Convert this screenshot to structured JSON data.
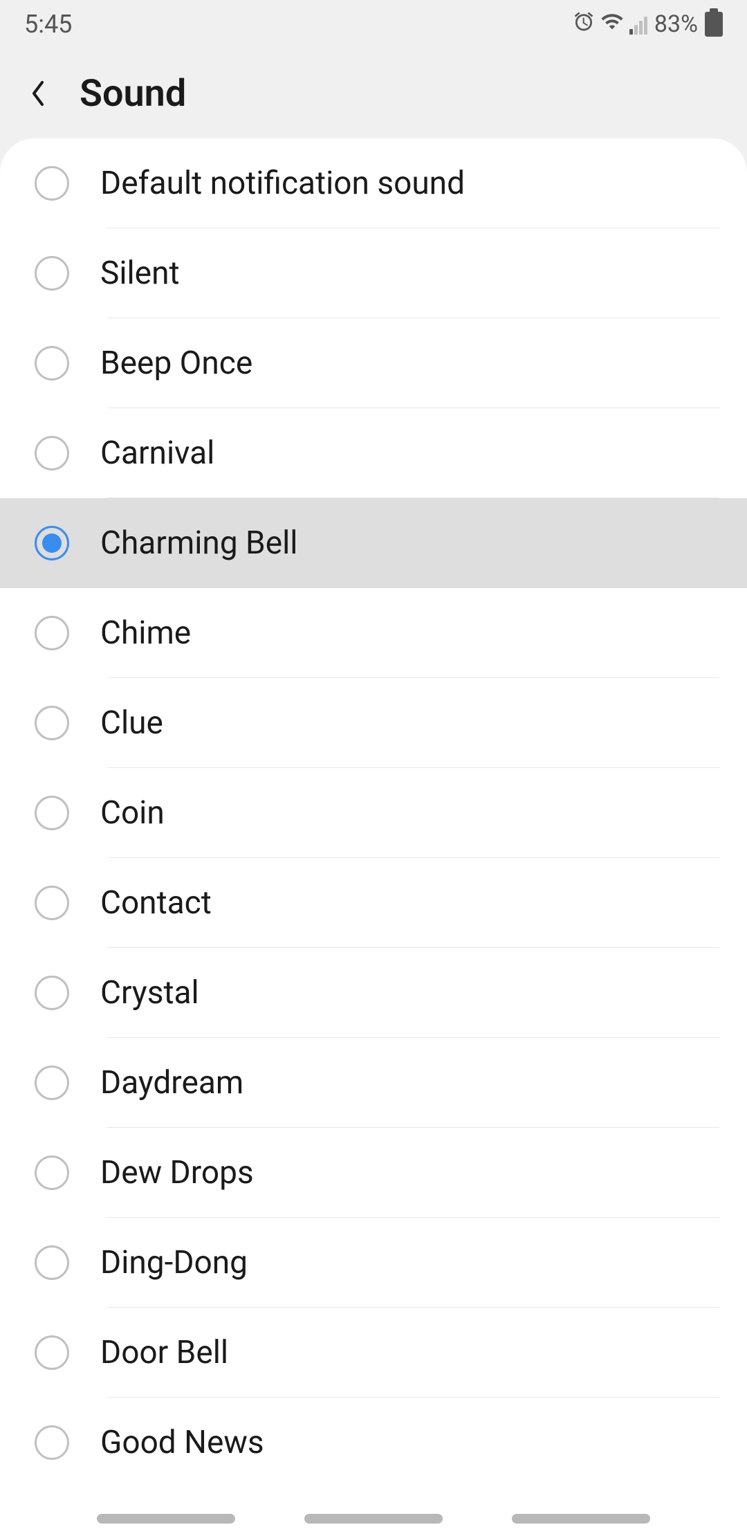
{
  "status": {
    "time": "5:45",
    "battery": "83%"
  },
  "header": {
    "title": "Sound"
  },
  "sounds": [
    {
      "label": "Default notification sound",
      "selected": false
    },
    {
      "label": "Silent",
      "selected": false
    },
    {
      "label": "Beep Once",
      "selected": false
    },
    {
      "label": "Carnival",
      "selected": false
    },
    {
      "label": "Charming Bell",
      "selected": true
    },
    {
      "label": "Chime",
      "selected": false
    },
    {
      "label": "Clue",
      "selected": false
    },
    {
      "label": "Coin",
      "selected": false
    },
    {
      "label": "Contact",
      "selected": false
    },
    {
      "label": "Crystal",
      "selected": false
    },
    {
      "label": "Daydream",
      "selected": false
    },
    {
      "label": "Dew Drops",
      "selected": false
    },
    {
      "label": "Ding-Dong",
      "selected": false
    },
    {
      "label": "Door Bell",
      "selected": false
    },
    {
      "label": "Good News",
      "selected": false
    }
  ]
}
